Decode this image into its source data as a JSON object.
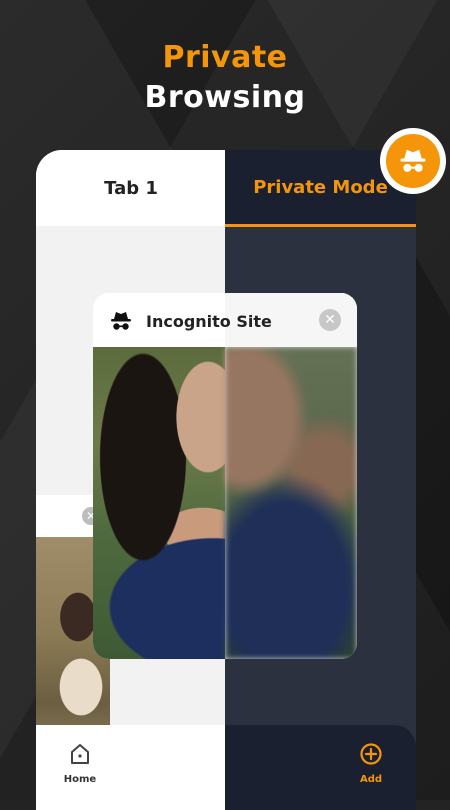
{
  "headline": {
    "line1": "Private",
    "line2": "Browsing"
  },
  "tabs": {
    "normal": "Tab 1",
    "private": "Private Mode"
  },
  "card": {
    "title": "Incognito Site",
    "close": "✕",
    "icon": "incognito-icon"
  },
  "side_card": {
    "close": "✕"
  },
  "bottom_nav": {
    "home": "Home",
    "add": "Add"
  },
  "colors": {
    "accent": "#F5960A",
    "private_bg": "#2c3140",
    "header_private": "#1b2030"
  }
}
